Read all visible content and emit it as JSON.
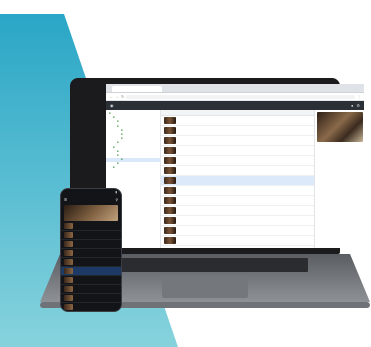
{
  "colors": {
    "background_accent": "#2ea9c7",
    "app_header": "#2b2f36",
    "selection": "#dce9fb",
    "laptop_body": "#1b1b1d",
    "phone_body": "#121417"
  },
  "browser": {
    "tab_label": "",
    "url": ""
  },
  "app": {
    "title": "",
    "header_icons": [
      "user-icon",
      "settings-icon"
    ]
  },
  "tree": {
    "items": [
      {
        "label": "",
        "indent": 0,
        "selected": false
      },
      {
        "label": "",
        "indent": 1,
        "selected": false
      },
      {
        "label": "",
        "indent": 2,
        "selected": false
      },
      {
        "label": "",
        "indent": 2,
        "selected": false
      },
      {
        "label": "",
        "indent": 3,
        "selected": false
      },
      {
        "label": "",
        "indent": 3,
        "selected": false
      },
      {
        "label": "",
        "indent": 3,
        "selected": false
      },
      {
        "label": "",
        "indent": 2,
        "selected": false
      },
      {
        "label": "",
        "indent": 1,
        "selected": false
      },
      {
        "label": "",
        "indent": 2,
        "selected": false
      },
      {
        "label": "",
        "indent": 2,
        "selected": false
      },
      {
        "label": "",
        "indent": 3,
        "selected": true
      },
      {
        "label": "",
        "indent": 2,
        "selected": false
      },
      {
        "label": "",
        "indent": 1,
        "selected": false
      }
    ]
  },
  "list": {
    "rows": [
      {
        "selected": false
      },
      {
        "selected": false
      },
      {
        "selected": false
      },
      {
        "selected": false
      },
      {
        "selected": false
      },
      {
        "selected": false
      },
      {
        "selected": true
      },
      {
        "selected": false
      },
      {
        "selected": false
      },
      {
        "selected": false
      },
      {
        "selected": false
      },
      {
        "selected": false
      },
      {
        "selected": false
      }
    ]
  },
  "details": {
    "lines": 22
  },
  "phone": {
    "time": "",
    "title": "",
    "rows": [
      {
        "selected": false
      },
      {
        "selected": false
      },
      {
        "selected": false
      },
      {
        "selected": false
      },
      {
        "selected": false
      },
      {
        "selected": true
      },
      {
        "selected": false
      },
      {
        "selected": false
      },
      {
        "selected": false
      },
      {
        "selected": false
      },
      {
        "selected": false
      }
    ]
  }
}
